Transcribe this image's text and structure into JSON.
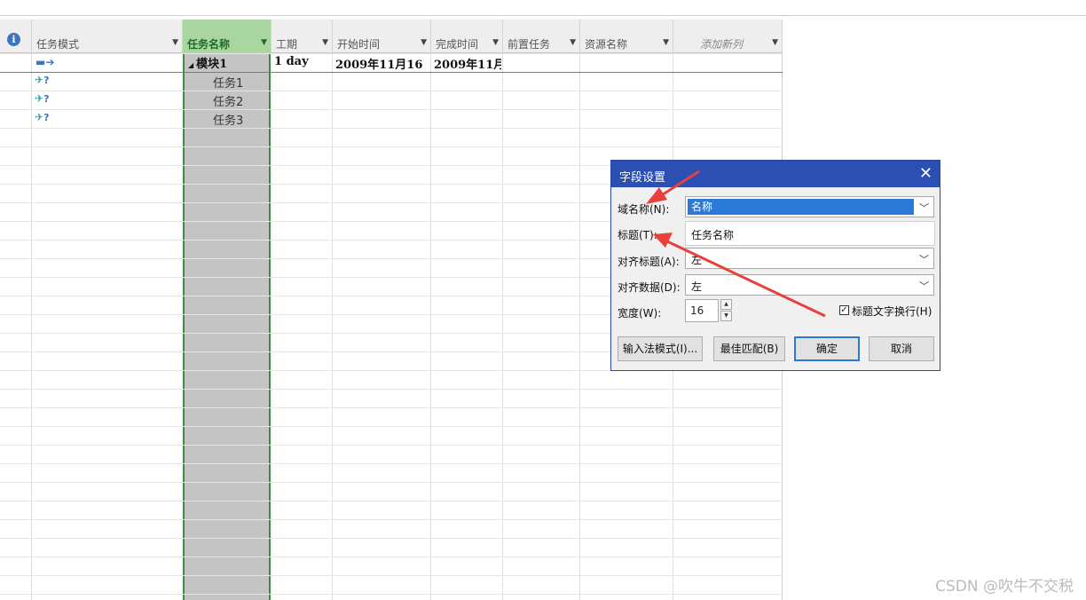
{
  "columns": [
    {
      "key": "mode",
      "label": "任务模式"
    },
    {
      "key": "name",
      "label": "任务名称"
    },
    {
      "key": "duration",
      "label": "工期"
    },
    {
      "key": "start",
      "label": "开始时间"
    },
    {
      "key": "finish",
      "label": "完成时间"
    },
    {
      "key": "pred",
      "label": "前置任务"
    },
    {
      "key": "resource",
      "label": "资源名称"
    },
    {
      "key": "add",
      "label": "添加新列"
    }
  ],
  "rows": [
    {
      "name": "模块1",
      "duration": "1 day",
      "start": "2009年11月16",
      "finish": "2009年11月",
      "summary_marker": "◢",
      "mode_icon": "auto-schedule-icon"
    },
    {
      "name": "任务1",
      "mode_icon": "manual-schedule-icon"
    },
    {
      "name": "任务2",
      "mode_icon": "manual-schedule-icon"
    },
    {
      "name": "任务3",
      "mode_icon": "manual-schedule-icon"
    }
  ],
  "dialog": {
    "title": "字段设置",
    "close_glyph": "✕",
    "field_name_label": "域名称(N):",
    "field_name_value": "名称",
    "title_label": "标题(T):",
    "title_value": "任务名称",
    "align_title_label": "对齐标题(A):",
    "align_title_value": "左",
    "align_data_label": "对齐数据(D):",
    "align_data_value": "左",
    "width_label": "宽度(W):",
    "width_value": "16",
    "wrap_label": "标题文字换行(H)",
    "wrap_checked": true,
    "buttons": {
      "ime": "输入法模式(I)...",
      "best_fit": "最佳匹配(B)",
      "ok": "确定",
      "cancel": "取消"
    }
  },
  "watermark": "CSDN @吹牛不交税",
  "colors": {
    "selected_header": "#a9d5a1",
    "selected_column": "#c4c4c4",
    "dialog_title": "#2b4fb3",
    "annotation_arrow": "#e8403a"
  }
}
